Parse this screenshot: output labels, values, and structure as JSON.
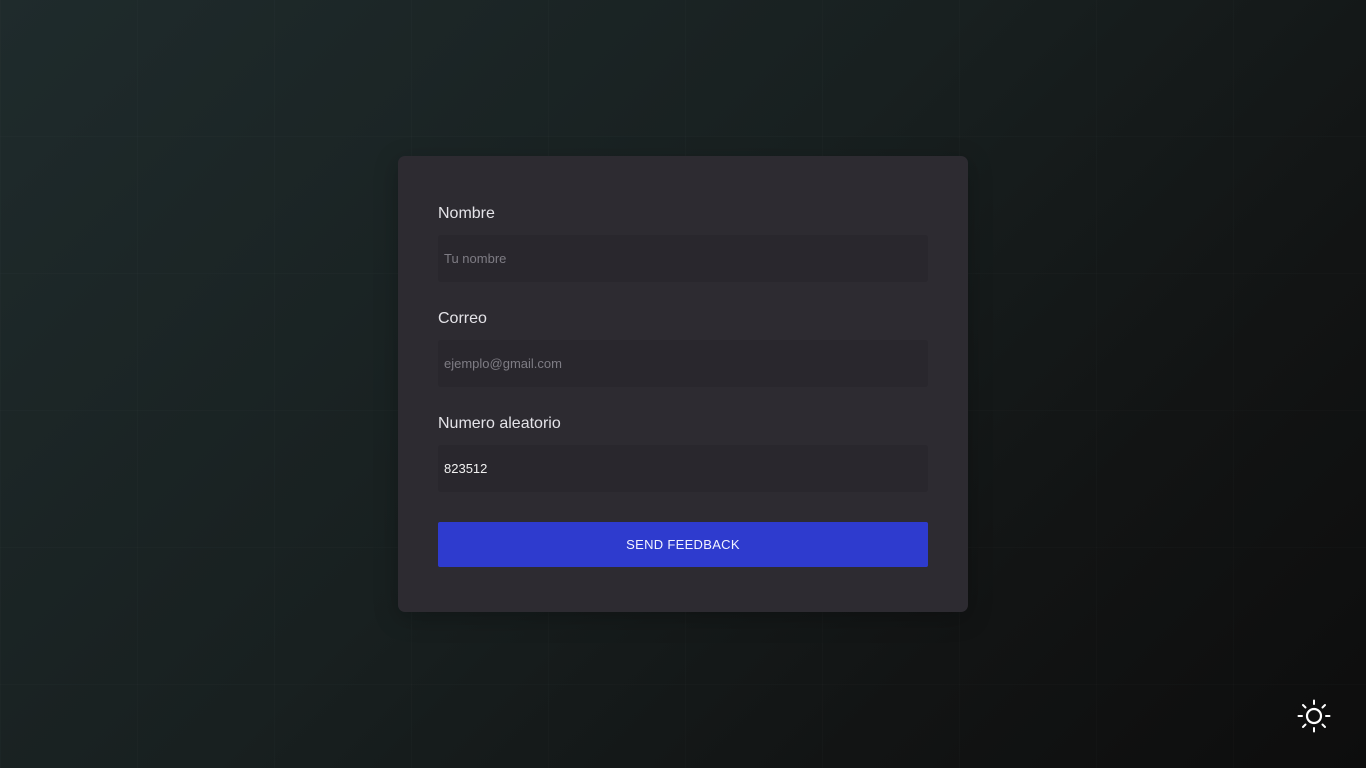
{
  "form": {
    "name": {
      "label": "Nombre",
      "placeholder": "Tu nombre",
      "value": ""
    },
    "email": {
      "label": "Correo",
      "placeholder": "ejemplo@gmail.com",
      "value": ""
    },
    "random_number": {
      "label": "Numero aleatorio",
      "placeholder": "",
      "value": "823512"
    },
    "submit_label": "SEND FEEDBACK"
  },
  "theme_toggle": {
    "icon": "sun-icon"
  },
  "colors": {
    "accent": "#2e3bce",
    "card_background": "#2d2b31",
    "input_background": "#29272d",
    "label_text": "#e4e3e8",
    "placeholder_text": "#7e7c84"
  }
}
